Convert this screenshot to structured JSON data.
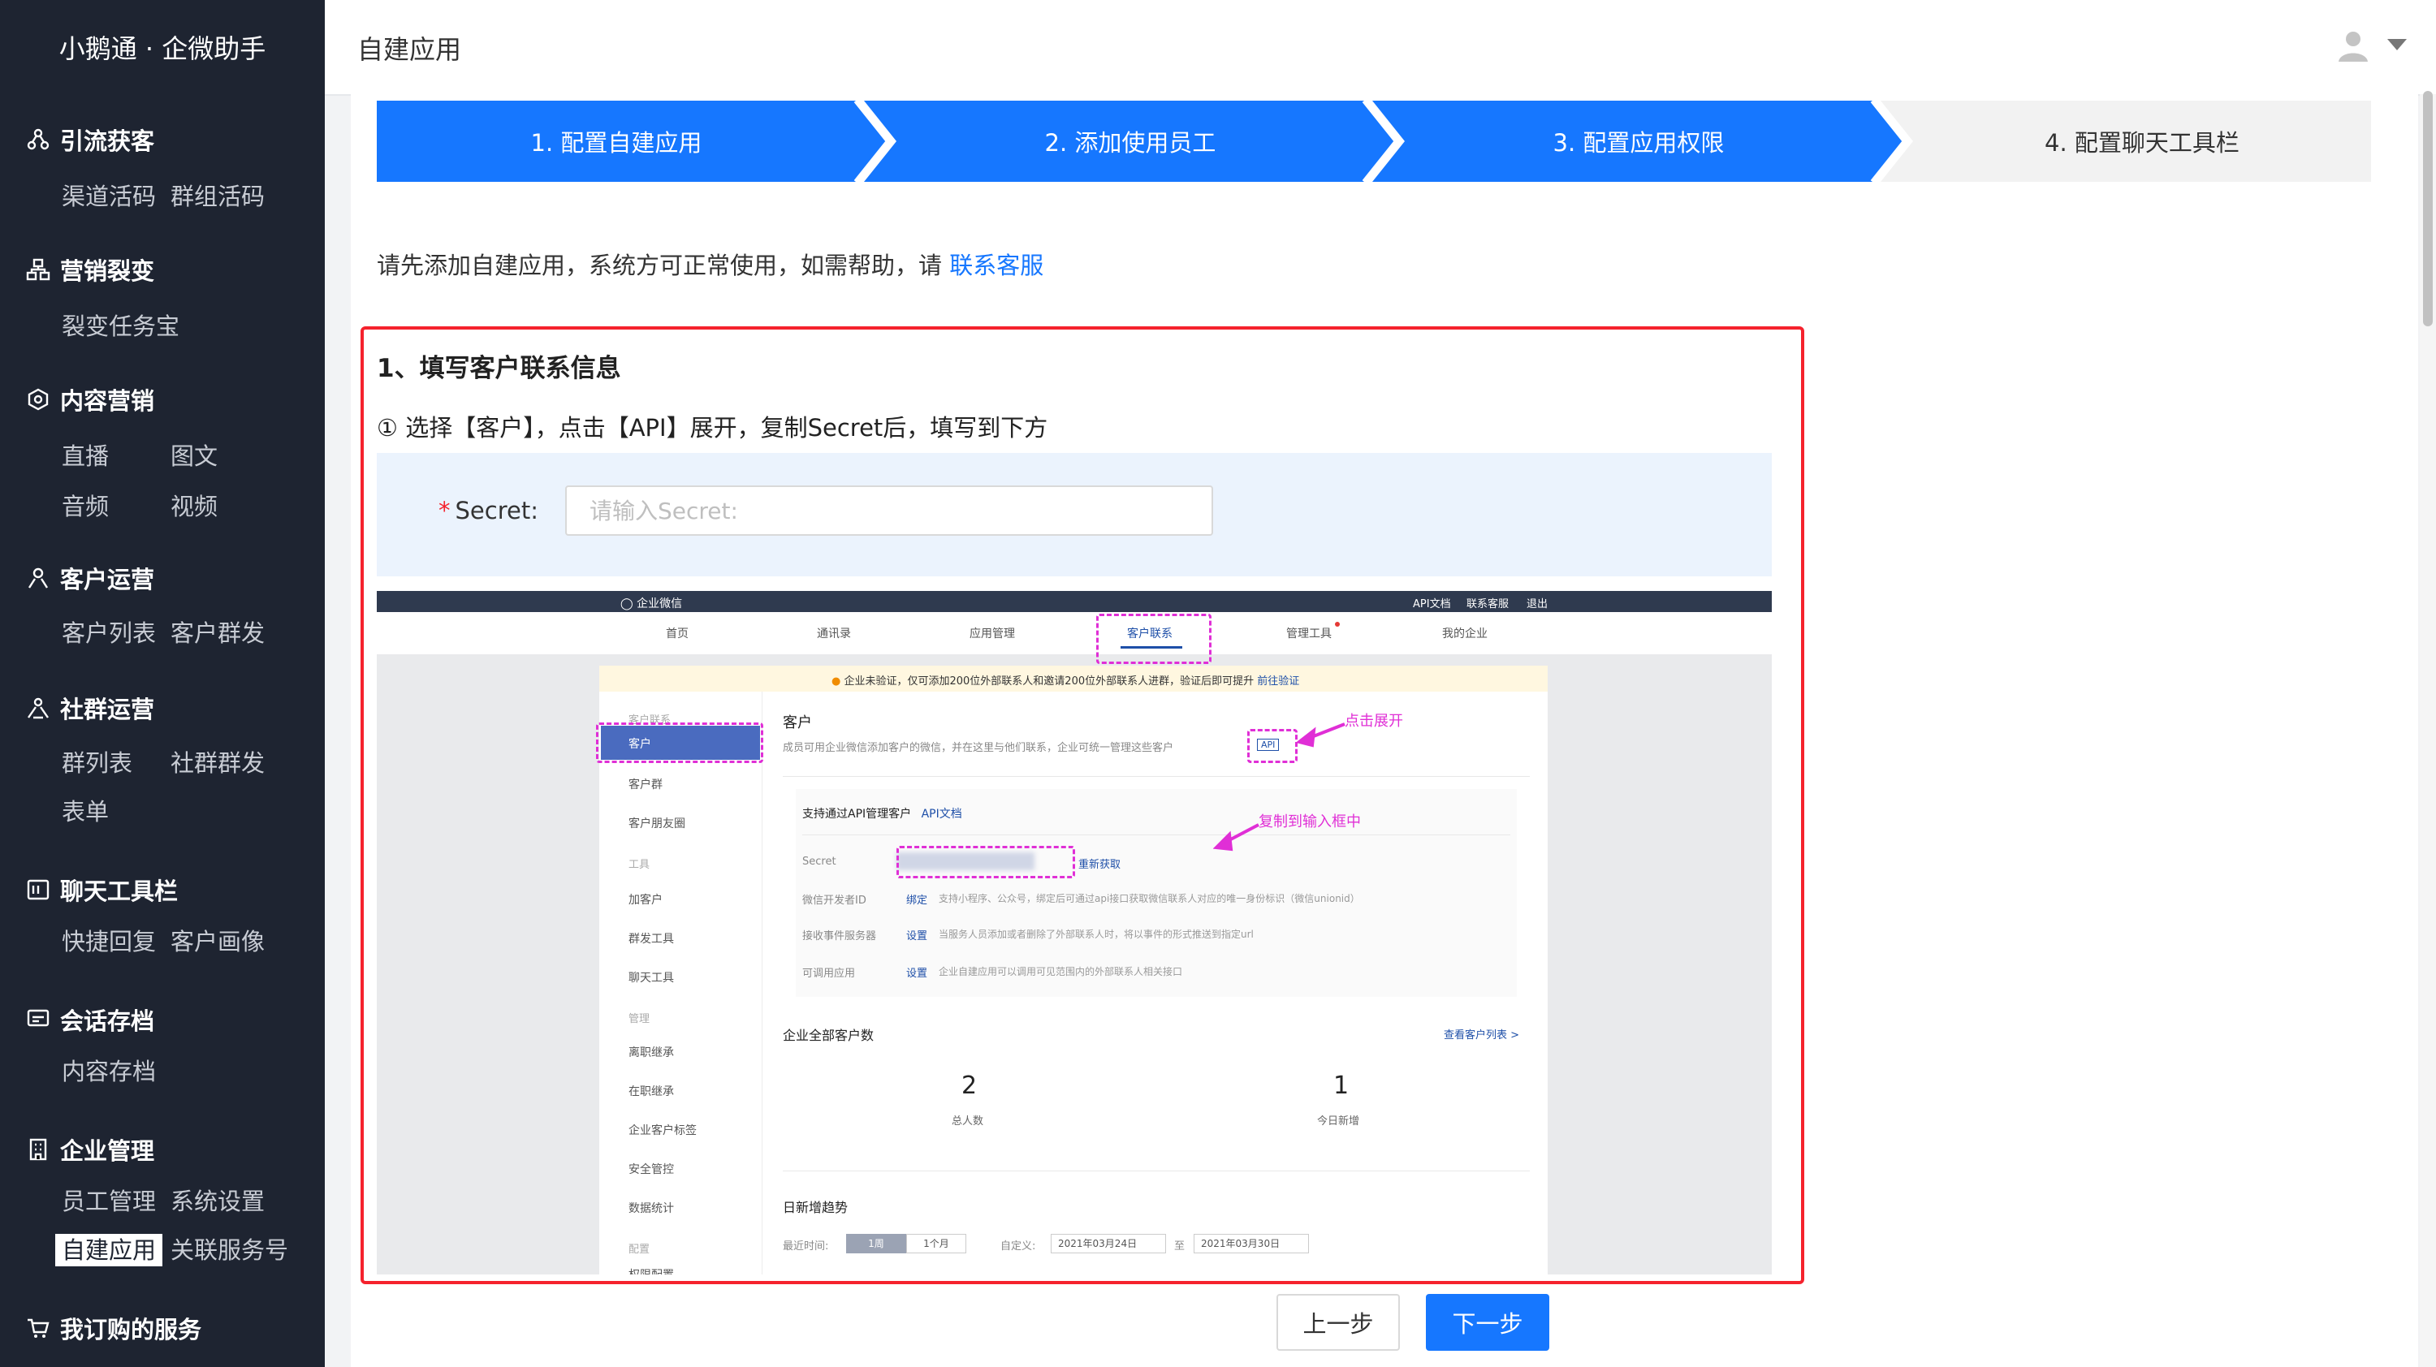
{
  "brand": "小鹅通 · 企微助手",
  "header": {
    "title": "自建应用"
  },
  "sidebar": {
    "groups": [
      {
        "title": "引流获客",
        "icon": "network-icon",
        "items": [
          "渠道活码",
          "群组活码"
        ]
      },
      {
        "title": "营销裂变",
        "icon": "hierarchy-icon",
        "items": [
          "裂变任务宝"
        ]
      },
      {
        "title": "内容营销",
        "icon": "settings-hex-icon",
        "items": [
          "直播",
          "图文",
          "音频",
          "视频"
        ]
      },
      {
        "title": "客户运营",
        "icon": "user-icon",
        "items": [
          "客户列表",
          "客户群发"
        ]
      },
      {
        "title": "社群运营",
        "icon": "group-icon",
        "items": [
          "群列表",
          "社群群发",
          "表单"
        ]
      },
      {
        "title": "聊天工具栏",
        "icon": "chat-toolbar-icon",
        "items": [
          "快捷回复",
          "客户画像"
        ]
      },
      {
        "title": "会话存档",
        "icon": "chat-archive-icon",
        "items": [
          "内容存档"
        ]
      },
      {
        "title": "企业管理",
        "icon": "building-icon",
        "items": [
          "员工管理",
          "系统设置",
          "自建应用",
          "关联服务号"
        ],
        "active": "自建应用"
      },
      {
        "title": "我订购的服务",
        "icon": "cart-icon",
        "items": []
      }
    ]
  },
  "steps": [
    "1. 配置自建应用",
    "2. 添加使用员工",
    "3. 配置应用权限",
    "4. 配置聊天工具栏"
  ],
  "colors": {
    "accent": "#1677ff",
    "sidebar_bg": "#1e2431",
    "danger": "#f5222d",
    "annotation": "#e02fd6"
  },
  "tip": {
    "text": "请先添加自建应用，系统方可正常使用，如需帮助，请",
    "link": "联系客服"
  },
  "panel": {
    "title": "1、填写客户联系信息",
    "subtitle": "① 选择【客户】，点击【API】展开，复制Secret后，填写到下方",
    "secret_label": "Secret:",
    "secret_placeholder": "请输入Secret:"
  },
  "screenshot": {
    "top_brand": "企业微信",
    "top_links": [
      "API文档",
      "联系客服",
      "退出"
    ],
    "nav": [
      "首页",
      "通讯录",
      "应用管理",
      "客户联系",
      "管理工具",
      "我的企业"
    ],
    "warning": "企业未验证，仅可添加200位外部联系人和邀请200位外部联系人进群，验证后即可提升",
    "warning_link": "前往验证",
    "left_menu": [
      "客户联系",
      "客户",
      "客户群",
      "客户朋友圈",
      "工具",
      "加客户",
      "群发工具",
      "聊天工具",
      "管理",
      "离职继承",
      "在职继承",
      "企业客户标签",
      "安全管控",
      "数据统计",
      "配置",
      "权限配置"
    ],
    "section_title": "客户",
    "section_desc": "成员可用企业微信添加客户的微信，并在这里与他们联系，企业可统一管理这些客户",
    "api_badge": "API",
    "api_title": "支持通过API管理客户",
    "api_doc": "API文档",
    "rows": [
      {
        "label": "Secret",
        "action": "重新获取",
        "desc": ""
      },
      {
        "label": "微信开发者ID",
        "action": "绑定",
        "desc": "支持小程序、公众号，绑定后可通过api接口获取微信联系人对应的唯一身份标识（微信unionid）"
      },
      {
        "label": "接收事件服务器",
        "action": "设置",
        "desc": "当服务人员添加或者删除了外部联系人时，将以事件的形式推送到指定url"
      },
      {
        "label": "可调用应用",
        "action": "设置",
        "desc": "企业自建应用可以调用可见范围内的外部联系人相关接口"
      }
    ],
    "stats_title": "企业全部客户数",
    "stats_link": "查看客户列表 >",
    "stats": [
      {
        "value": "2",
        "label": "总人数"
      },
      {
        "value": "1",
        "label": "今日新增"
      }
    ],
    "trend_title": "日新增趋势",
    "trend_label": "最近时间:",
    "trend_week": "1周",
    "trend_month": "1个月",
    "custom_label": "自定义:",
    "date_from": "2021年03月24日",
    "date_sep": "至",
    "date_to": "2021年03月30日",
    "annotation_expand": "点击展开",
    "annotation_copy": "复制到输入框中"
  },
  "buttons": {
    "prev": "上一步",
    "next": "下一步"
  }
}
